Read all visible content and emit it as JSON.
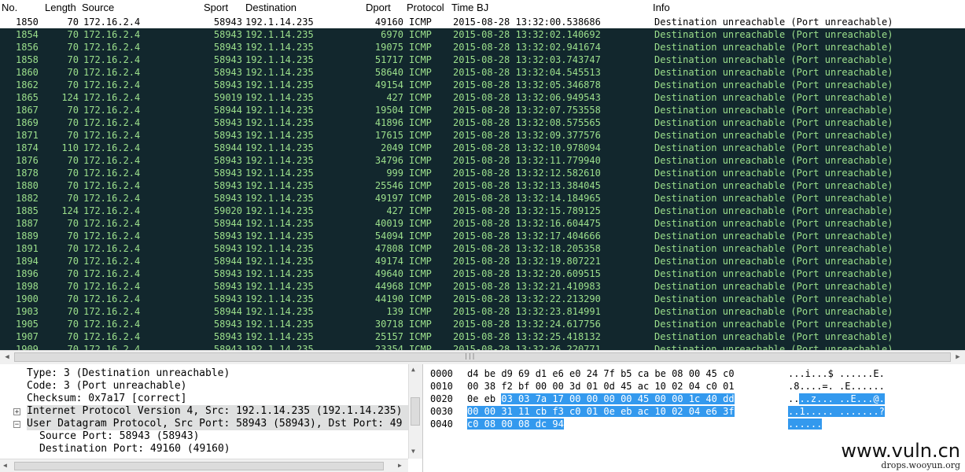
{
  "columns": {
    "no": "No.",
    "length": "Length",
    "source": "Source",
    "sport": "Sport",
    "destination": "Destination",
    "dport": "Dport",
    "protocol": "Protocol",
    "time": "Time BJ",
    "info": "Info"
  },
  "packets": [
    {
      "no": "1850",
      "len": "70",
      "src": "172.16.2.4",
      "sport": "58943",
      "dst": "192.1.14.235",
      "dport": "49160",
      "proto": "ICMP",
      "time": "2015-08-28 13:32:00.538686",
      "info": "Destination unreachable (Port unreachable)",
      "selected": true
    },
    {
      "no": "1854",
      "len": "70",
      "src": "172.16.2.4",
      "sport": "58943",
      "dst": "192.1.14.235",
      "dport": "6970",
      "proto": "ICMP",
      "time": "2015-08-28 13:32:02.140692",
      "info": "Destination unreachable (Port unreachable)"
    },
    {
      "no": "1856",
      "len": "70",
      "src": "172.16.2.4",
      "sport": "58943",
      "dst": "192.1.14.235",
      "dport": "19075",
      "proto": "ICMP",
      "time": "2015-08-28 13:32:02.941674",
      "info": "Destination unreachable (Port unreachable)"
    },
    {
      "no": "1858",
      "len": "70",
      "src": "172.16.2.4",
      "sport": "58943",
      "dst": "192.1.14.235",
      "dport": "51717",
      "proto": "ICMP",
      "time": "2015-08-28 13:32:03.743747",
      "info": "Destination unreachable (Port unreachable)"
    },
    {
      "no": "1860",
      "len": "70",
      "src": "172.16.2.4",
      "sport": "58943",
      "dst": "192.1.14.235",
      "dport": "58640",
      "proto": "ICMP",
      "time": "2015-08-28 13:32:04.545513",
      "info": "Destination unreachable (Port unreachable)"
    },
    {
      "no": "1862",
      "len": "70",
      "src": "172.16.2.4",
      "sport": "58943",
      "dst": "192.1.14.235",
      "dport": "49154",
      "proto": "ICMP",
      "time": "2015-08-28 13:32:05.346878",
      "info": "Destination unreachable (Port unreachable)"
    },
    {
      "no": "1865",
      "len": "124",
      "src": "172.16.2.4",
      "sport": "59019",
      "dst": "192.1.14.235",
      "dport": "427",
      "proto": "ICMP",
      "time": "2015-08-28 13:32:06.949543",
      "info": "Destination unreachable (Port unreachable)"
    },
    {
      "no": "1867",
      "len": "70",
      "src": "172.16.2.4",
      "sport": "58944",
      "dst": "192.1.14.235",
      "dport": "19504",
      "proto": "ICMP",
      "time": "2015-08-28 13:32:07.753558",
      "info": "Destination unreachable (Port unreachable)"
    },
    {
      "no": "1869",
      "len": "70",
      "src": "172.16.2.4",
      "sport": "58943",
      "dst": "192.1.14.235",
      "dport": "41896",
      "proto": "ICMP",
      "time": "2015-08-28 13:32:08.575565",
      "info": "Destination unreachable (Port unreachable)"
    },
    {
      "no": "1871",
      "len": "70",
      "src": "172.16.2.4",
      "sport": "58943",
      "dst": "192.1.14.235",
      "dport": "17615",
      "proto": "ICMP",
      "time": "2015-08-28 13:32:09.377576",
      "info": "Destination unreachable (Port unreachable)"
    },
    {
      "no": "1874",
      "len": "110",
      "src": "172.16.2.4",
      "sport": "58944",
      "dst": "192.1.14.235",
      "dport": "2049",
      "proto": "ICMP",
      "time": "2015-08-28 13:32:10.978094",
      "info": "Destination unreachable (Port unreachable)"
    },
    {
      "no": "1876",
      "len": "70",
      "src": "172.16.2.4",
      "sport": "58943",
      "dst": "192.1.14.235",
      "dport": "34796",
      "proto": "ICMP",
      "time": "2015-08-28 13:32:11.779940",
      "info": "Destination unreachable (Port unreachable)"
    },
    {
      "no": "1878",
      "len": "70",
      "src": "172.16.2.4",
      "sport": "58943",
      "dst": "192.1.14.235",
      "dport": "999",
      "proto": "ICMP",
      "time": "2015-08-28 13:32:12.582610",
      "info": "Destination unreachable (Port unreachable)"
    },
    {
      "no": "1880",
      "len": "70",
      "src": "172.16.2.4",
      "sport": "58943",
      "dst": "192.1.14.235",
      "dport": "25546",
      "proto": "ICMP",
      "time": "2015-08-28 13:32:13.384045",
      "info": "Destination unreachable (Port unreachable)"
    },
    {
      "no": "1882",
      "len": "70",
      "src": "172.16.2.4",
      "sport": "58943",
      "dst": "192.1.14.235",
      "dport": "49197",
      "proto": "ICMP",
      "time": "2015-08-28 13:32:14.184965",
      "info": "Destination unreachable (Port unreachable)"
    },
    {
      "no": "1885",
      "len": "124",
      "src": "172.16.2.4",
      "sport": "59020",
      "dst": "192.1.14.235",
      "dport": "427",
      "proto": "ICMP",
      "time": "2015-08-28 13:32:15.789125",
      "info": "Destination unreachable (Port unreachable)"
    },
    {
      "no": "1887",
      "len": "70",
      "src": "172.16.2.4",
      "sport": "58944",
      "dst": "192.1.14.235",
      "dport": "40019",
      "proto": "ICMP",
      "time": "2015-08-28 13:32:16.604475",
      "info": "Destination unreachable (Port unreachable)"
    },
    {
      "no": "1889",
      "len": "70",
      "src": "172.16.2.4",
      "sport": "58943",
      "dst": "192.1.14.235",
      "dport": "54094",
      "proto": "ICMP",
      "time": "2015-08-28 13:32:17.404666",
      "info": "Destination unreachable (Port unreachable)"
    },
    {
      "no": "1891",
      "len": "70",
      "src": "172.16.2.4",
      "sport": "58943",
      "dst": "192.1.14.235",
      "dport": "47808",
      "proto": "ICMP",
      "time": "2015-08-28 13:32:18.205358",
      "info": "Destination unreachable (Port unreachable)"
    },
    {
      "no": "1894",
      "len": "70",
      "src": "172.16.2.4",
      "sport": "58944",
      "dst": "192.1.14.235",
      "dport": "49174",
      "proto": "ICMP",
      "time": "2015-08-28 13:32:19.807221",
      "info": "Destination unreachable (Port unreachable)"
    },
    {
      "no": "1896",
      "len": "70",
      "src": "172.16.2.4",
      "sport": "58943",
      "dst": "192.1.14.235",
      "dport": "49640",
      "proto": "ICMP",
      "time": "2015-08-28 13:32:20.609515",
      "info": "Destination unreachable (Port unreachable)"
    },
    {
      "no": "1898",
      "len": "70",
      "src": "172.16.2.4",
      "sport": "58943",
      "dst": "192.1.14.235",
      "dport": "44968",
      "proto": "ICMP",
      "time": "2015-08-28 13:32:21.410983",
      "info": "Destination unreachable (Port unreachable)"
    },
    {
      "no": "1900",
      "len": "70",
      "src": "172.16.2.4",
      "sport": "58943",
      "dst": "192.1.14.235",
      "dport": "44190",
      "proto": "ICMP",
      "time": "2015-08-28 13:32:22.213290",
      "info": "Destination unreachable (Port unreachable)"
    },
    {
      "no": "1903",
      "len": "70",
      "src": "172.16.2.4",
      "sport": "58944",
      "dst": "192.1.14.235",
      "dport": "139",
      "proto": "ICMP",
      "time": "2015-08-28 13:32:23.814991",
      "info": "Destination unreachable (Port unreachable)"
    },
    {
      "no": "1905",
      "len": "70",
      "src": "172.16.2.4",
      "sport": "58943",
      "dst": "192.1.14.235",
      "dport": "30718",
      "proto": "ICMP",
      "time": "2015-08-28 13:32:24.617756",
      "info": "Destination unreachable (Port unreachable)"
    },
    {
      "no": "1907",
      "len": "70",
      "src": "172.16.2.4",
      "sport": "58943",
      "dst": "192.1.14.235",
      "dport": "25157",
      "proto": "ICMP",
      "time": "2015-08-28 13:32:25.418132",
      "info": "Destination unreachable (Port unreachable)"
    },
    {
      "no": "1909",
      "len": "70",
      "src": "172.16.2.4",
      "sport": "58943",
      "dst": "192.1.14.235",
      "dport": "23354",
      "proto": "ICMP",
      "time": "2015-08-28 13:32:26.220771",
      "info": "Destination unreachable (Port unreachable)"
    }
  ],
  "details": {
    "type": "Type: 3 (Destination unreachable)",
    "code": "Code: 3 (Port unreachable)",
    "checksum": "Checksum: 0x7a17 [correct]",
    "ip": "Internet Protocol Version 4, Src: 192.1.14.235 (192.1.14.235)",
    "udp": "User Datagram Protocol, Src Port: 58943 (58943), Dst Port: 49",
    "srcport": "Source Port: 58943 (58943)",
    "dstport": "Destination Port: 49160 (49160)",
    "expand_plus": "+",
    "expand_minus": "−"
  },
  "bytes": {
    "offsets": [
      "0000",
      "0010",
      "0020",
      "0030",
      "0040"
    ],
    "l0_hex": "d4 be d9 69 d1 e6 e0 24  7f b5 ca be 08 00 45 c0",
    "l1_hex": "00 38 f2 bf 00 00 3d 01  0d 45 ac 10 02 04 c0 01",
    "l2_hex_a": "0e eb ",
    "l2_hex_b": "03 03 7a 17 00 00  00 00 45 00 00 1c 40 dd",
    "l3_hex": "00 00 31 11 cb f3 c0 01  0e eb ac 10 02 04 e6 3f",
    "l4_hex": "c0 08 00 08 dc 94",
    "l0_ascii": "...i...$ ......E.",
    "l1_ascii": ".8....=. .E......",
    "l2_ascii_a": "..",
    "l2_ascii_b": "..z... ..E...@.",
    "l3_ascii": "..1..... .......?",
    "l4_ascii": "......"
  },
  "scroll_icons": {
    "left": "◀",
    "right": "▶",
    "up": "▲",
    "down": "▼",
    "grip": "|||"
  },
  "watermark": {
    "main": "www.vuln.cn",
    "sub": "drops.wooyun.org"
  },
  "colors": {
    "list_bg": "#12272d",
    "list_text": "#9ce08c",
    "selected_row": "#ffffff",
    "byte_highlight": "#3399ee"
  }
}
